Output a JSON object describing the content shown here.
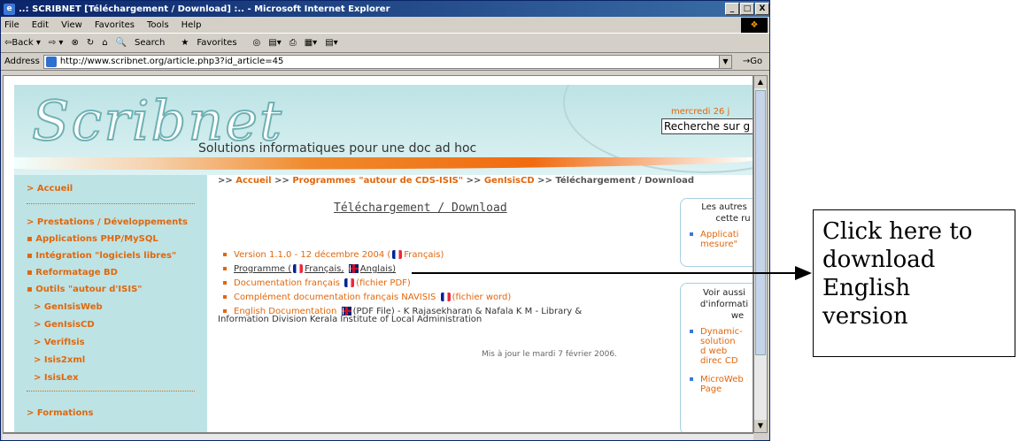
{
  "window": {
    "title": "..: SCRIBNET [Téléchargement / Download] :.. - Microsoft Internet Explorer",
    "controls": [
      "_",
      "□",
      "X"
    ]
  },
  "menu": [
    "File",
    "Edit",
    "View",
    "Favorites",
    "Tools",
    "Help"
  ],
  "toolbar": {
    "back": "⇦Back ▾",
    "forward": "⇨ ▾",
    "stop": "⊗",
    "refresh": "↻",
    "home": "⌂",
    "search": "Search",
    "favorites": "Favorites",
    "media": "◎",
    "history": "▤▾",
    "print": "⎙",
    "edit": "▦▾",
    "discuss": "▤▾"
  },
  "address": {
    "label": "Address",
    "url": "http://www.scribnet.org/article.php3?id_article=45",
    "go": "Go"
  },
  "site": {
    "logo": "Scribnet",
    "tagline": "Solutions informatiques pour une doc ad hoc",
    "date": "mercredi 26 j",
    "search_value": "Recherche sur g"
  },
  "sidebar": {
    "items": [
      "> Accueil",
      "> Prestations / Développements",
      "▪ Applications PHP/MySQL",
      "▪ Intégration \"logiciels libres\"",
      "▪ Reformatage BD",
      "▪ Outils \"autour d'ISIS\"",
      "> GenIsisWeb",
      "> GenIsisCD",
      "> VerifIsis",
      "> Isis2xml",
      "> IsisLex",
      "> Formations"
    ]
  },
  "breadcrumb": {
    "sep": ">>",
    "home": "Accueil",
    "section": "Programmes \"autour de CDS-ISIS\"",
    "sub": "GenIsisCD",
    "current": "Téléchargement / Download"
  },
  "article": {
    "title": "Téléchargement / Download",
    "items": [
      {
        "a": "Version 1.1.0 - 12 décembre 2004 (",
        "b": "Français)"
      },
      {
        "a": "Programme (",
        "b": "Français,",
        "c": "Anglais)"
      },
      {
        "a": "Documentation français",
        "b": "(fichier PDF)"
      },
      {
        "a": "Complément documentation français NAVISIS",
        "b": "(fichier word)"
      },
      {
        "a": "English Documentation",
        "b": "(PDF File) - K Rajasekharan & Nafala K M - Library &"
      }
    ],
    "continuation": "Information Division Kerala Institute of Local Administration",
    "updated": "Mis à jour le mardi 7 février 2006."
  },
  "box1": {
    "title_l1": "Les autres",
    "title_l2": "cette ru",
    "links": [
      "Applicati mesure\""
    ]
  },
  "box2": {
    "title_l1": "Voir aussi",
    "title_l2": "d'informati",
    "title_l3": "we",
    "links": [
      "Dynamic- solution d web direc CD",
      "MicroWeb Page"
    ]
  },
  "callout": {
    "line1": "Click here to",
    "line2": "download",
    "line3": "English",
    "line4": "version"
  },
  "colors": {
    "accent": "#e1670c",
    "sidebar_bg": "#bde3e5",
    "title_bar": "#0a246a"
  }
}
